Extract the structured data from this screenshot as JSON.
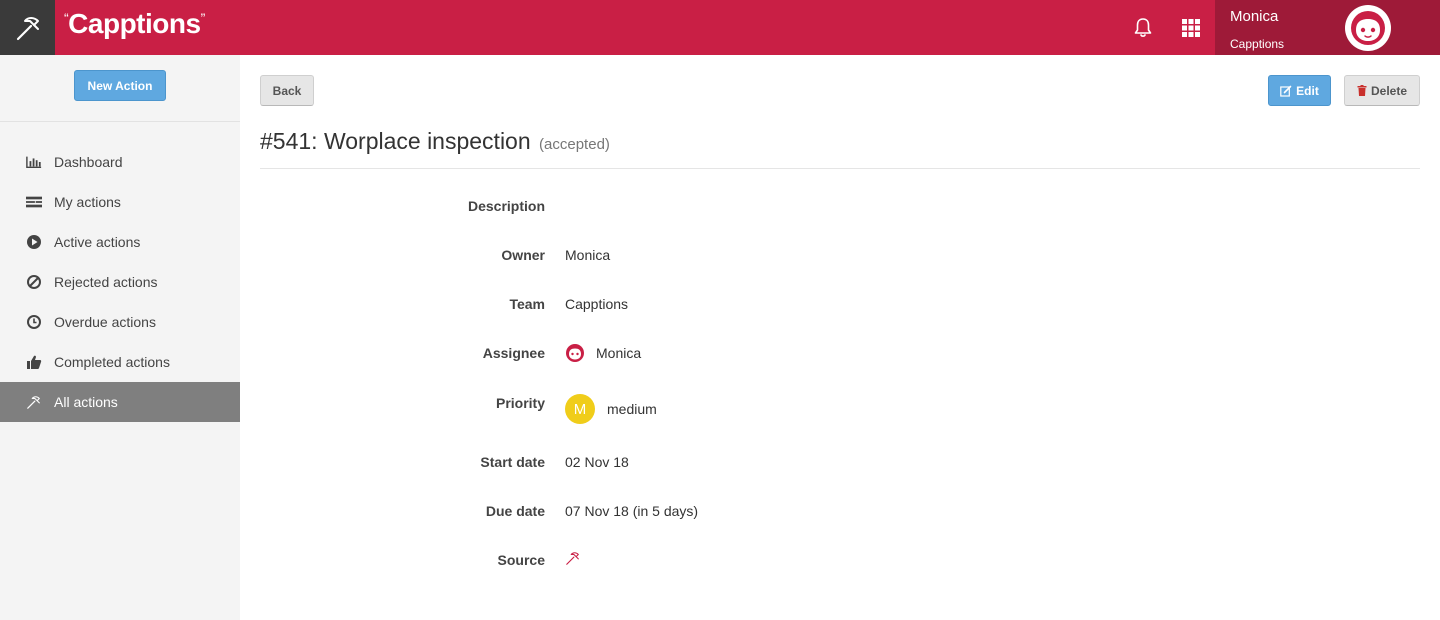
{
  "header": {
    "brand": "Capptions",
    "user_name": "Monica",
    "user_team": "Capptions"
  },
  "sidebar": {
    "new_action_label": "New Action",
    "items": [
      {
        "label": "Dashboard",
        "icon": "bar-chart-icon"
      },
      {
        "label": "My actions",
        "icon": "list-icon"
      },
      {
        "label": "Active actions",
        "icon": "play-circle-icon"
      },
      {
        "label": "Rejected actions",
        "icon": "ban-icon"
      },
      {
        "label": "Overdue actions",
        "icon": "clock-icon"
      },
      {
        "label": "Completed actions",
        "icon": "thumbs-up-icon"
      },
      {
        "label": "All actions",
        "icon": "hammer-icon",
        "active": true
      }
    ]
  },
  "toolbar": {
    "back_label": "Back",
    "edit_label": "Edit",
    "delete_label": "Delete"
  },
  "action": {
    "title": "#541: Worplace inspection",
    "status": "(accepted)"
  },
  "details": {
    "labels": {
      "description": "Description",
      "owner": "Owner",
      "team": "Team",
      "assignee": "Assignee",
      "priority": "Priority",
      "start_date": "Start date",
      "due_date": "Due date",
      "source": "Source"
    },
    "owner": "Monica",
    "team": "Capptions",
    "assignee": "Monica",
    "priority_badge": "M",
    "priority": "medium",
    "start_date": "02 Nov 18",
    "due_date": "07 Nov 18 (in 5 days)"
  },
  "colors": {
    "brand_red": "#c91f45",
    "brand_dark_red": "#9e1a38",
    "primary_blue": "#5fa8e0",
    "priority_yellow": "#f0cd1a",
    "active_nav": "#7f7f7f"
  }
}
